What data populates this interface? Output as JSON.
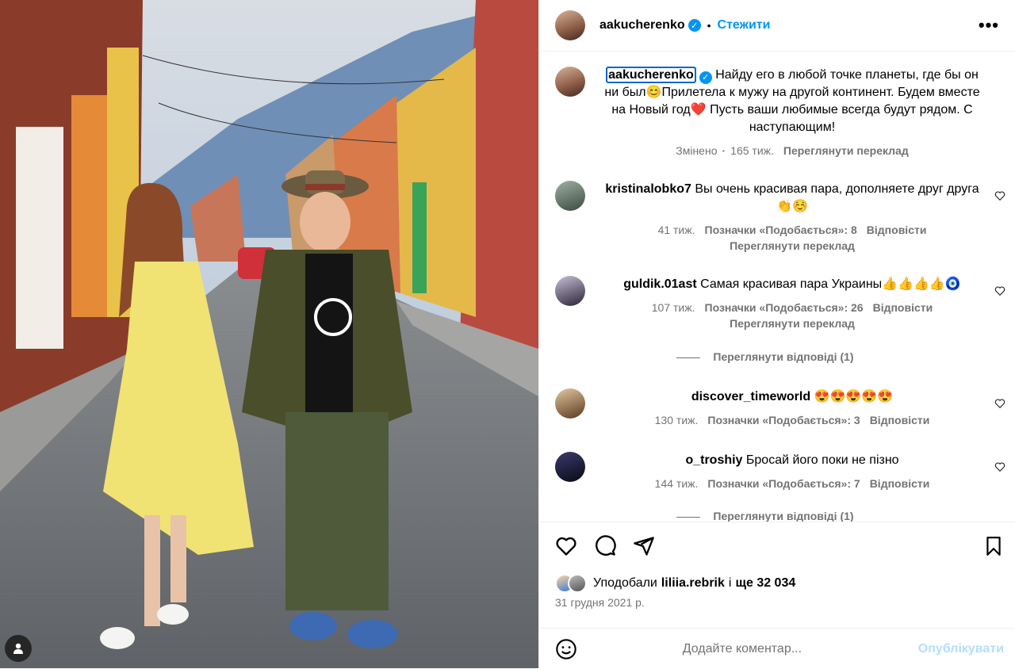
{
  "post": {
    "username": "aakucherenko",
    "follow": "Стежити",
    "dot": "•",
    "more": "•••",
    "caption": "Найду его в любой точке планеты, где бы он ни был😊Прилетела к мужу на другой континент. Будем вместе на Новый год❤️ Пусть ваши любимые всегда будут рядом. С наступающим!",
    "caption_edited": "Змінено",
    "caption_time": "165 тиж.",
    "caption_translate": "Переглянути переклад"
  },
  "comments": [
    {
      "user": "kristinalobko7",
      "text": "Вы очень красивая пара, дополняете друг друга👏☺️",
      "time": "41 тиж.",
      "likes": "Позначки «Подобається»: 8",
      "reply": "Відповісти",
      "translate": "Переглянути переклад"
    },
    {
      "user": "guldik.01ast",
      "text": "Самая красивая пара Украины👍👍👍👍🧿",
      "time": "107 тиж.",
      "likes": "Позначки «Подобається»: 26",
      "reply": "Відповісти",
      "translate": "Переглянути переклад",
      "view_replies": "Переглянути відповіді (1)"
    },
    {
      "user": "discover_timeworld",
      "text": "😍😍😍😍😍",
      "time": "130 тиж.",
      "likes": "Позначки «Подобається»: 3",
      "reply": "Відповісти"
    },
    {
      "user": "o_troshiy",
      "text": "Бросай його поки не пізно",
      "time": "144 тиж.",
      "likes": "Позначки «Подобається»: 7",
      "reply": "Відповісти",
      "view_replies": "Переглянути відповіді (1)"
    }
  ],
  "likes": {
    "prefix": "Уподобали",
    "user": "liliia.rebrik",
    "mid": "і",
    "rest": "ще 32 034"
  },
  "date": "31 грудня 2021 р.",
  "comment_box": {
    "placeholder": "Додайте коментар...",
    "publish": "Опублікувати"
  },
  "icons": [
    "heart-icon",
    "comment-icon",
    "share-icon",
    "bookmark-icon",
    "emoji-icon",
    "user-tag-icon",
    "verified-icon"
  ],
  "colors": {
    "accent": "#0095f6",
    "publish_disabled": "#b2dffc",
    "muted": "#737373"
  }
}
